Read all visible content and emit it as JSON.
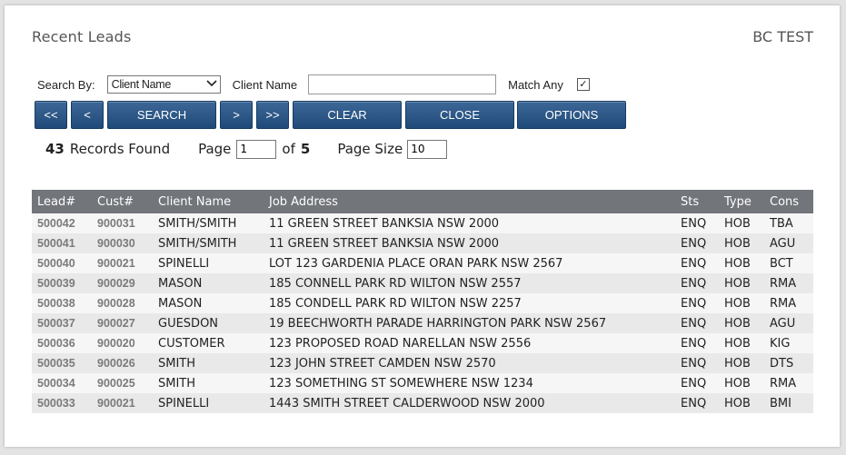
{
  "header": {
    "title": "Recent Leads",
    "company": "BC TEST"
  },
  "search": {
    "search_by_label": "Search By:",
    "search_by_value": "Client Name",
    "field_label": "Client Name",
    "field_value": "",
    "match_any_label": "Match Any",
    "match_any_checked": true,
    "check_glyph": "✓"
  },
  "buttons": {
    "first": "<<",
    "prev": "<",
    "search": "SEARCH",
    "next": ">",
    "last": ">>",
    "clear": "CLEAR",
    "close": "CLOSE",
    "options": "OPTIONS"
  },
  "results": {
    "count": "43",
    "records_found_label": "Records Found",
    "page_label": "Page",
    "page_value": "1",
    "of_label": "of",
    "total_pages": "5",
    "page_size_label": "Page Size",
    "page_size_value": "10"
  },
  "table": {
    "columns": [
      "Lead#",
      "Cust#",
      "Client Name",
      "Job Address",
      "Sts",
      "Type",
      "Cons"
    ],
    "rows": [
      [
        "500042",
        "900031",
        "SMITH/SMITH",
        "11 GREEN STREET BANKSIA NSW 2000",
        "ENQ",
        "HOB",
        "TBA"
      ],
      [
        "500041",
        "900030",
        "SMITH/SMITH",
        "11 GREEN STREET BANKSIA NSW 2000",
        "ENQ",
        "HOB",
        "AGU"
      ],
      [
        "500040",
        "900021",
        "SPINELLI",
        "LOT 123 GARDENIA PLACE ORAN PARK NSW 2567",
        "ENQ",
        "HOB",
        "BCT"
      ],
      [
        "500039",
        "900029",
        "MASON",
        "185 CONNELL PARK RD WILTON NSW 2557",
        "ENQ",
        "HOB",
        "RMA"
      ],
      [
        "500038",
        "900028",
        "MASON",
        "185 CONDELL PARK RD WILTON NSW 2257",
        "ENQ",
        "HOB",
        "RMA"
      ],
      [
        "500037",
        "900027",
        "GUESDON",
        "19 BEECHWORTH PARADE HARRINGTON PARK NSW 2567",
        "ENQ",
        "HOB",
        "AGU"
      ],
      [
        "500036",
        "900020",
        "CUSTOMER",
        "123 PROPOSED ROAD NARELLAN NSW 2556",
        "ENQ",
        "HOB",
        "KIG"
      ],
      [
        "500035",
        "900026",
        "SMITH",
        "123 JOHN STREET CAMDEN NSW 2570",
        "ENQ",
        "HOB",
        "DTS"
      ],
      [
        "500034",
        "900025",
        "SMITH",
        "123 SOMETHING ST SOMEWHERE NSW 1234",
        "ENQ",
        "HOB",
        "RMA"
      ],
      [
        "500033",
        "900021",
        "SPINELLI",
        "1443 SMITH STREET CALDERWOOD NSW 2000",
        "ENQ",
        "HOB",
        "BMI"
      ]
    ]
  },
  "colors": {
    "button": "#2b5686",
    "header_row": "#72757a",
    "id_text": "#7a7a7a"
  }
}
